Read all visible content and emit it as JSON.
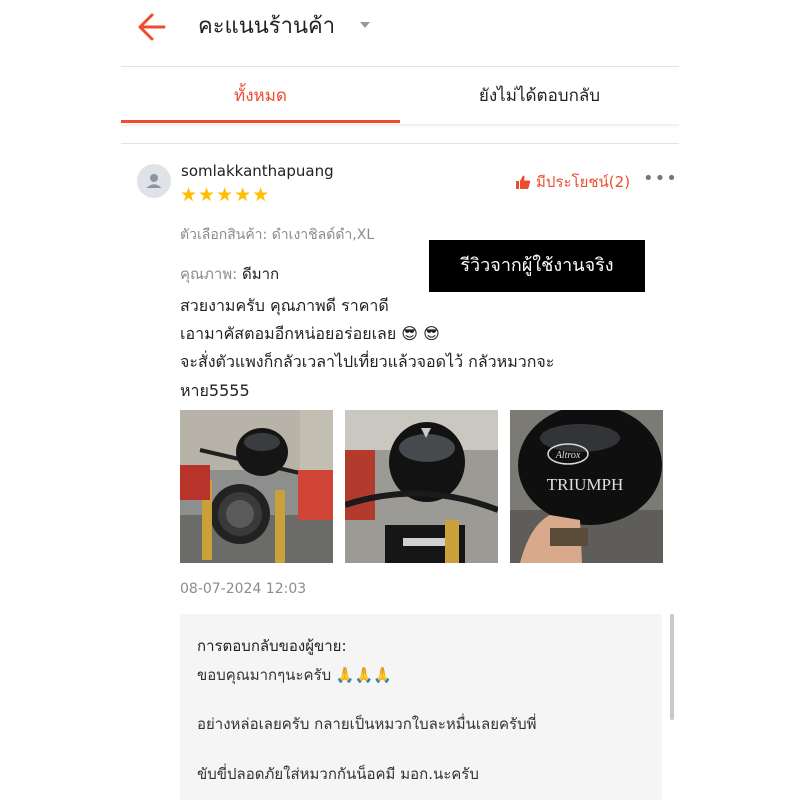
{
  "header": {
    "back_icon": "arrow-left-icon",
    "title": "คะแนนร้านค้า",
    "dropdown_icon": "caret-down-icon",
    "accent_color": "#ee4d2d"
  },
  "tabs": [
    {
      "label": "ทั้งหมด",
      "active": true
    },
    {
      "label": "ยังไม่ได้ตอบกลับ",
      "active": false
    }
  ],
  "review": {
    "username": "somlakkanthapuang",
    "rating": 5,
    "stars": "★★★★★",
    "star_color": "#ffbf00",
    "helpful_label": "มีประโยชน์(2)",
    "more_icon": "•••",
    "variation": "ตัวเลือกสินค้า: ดำเงาชิลด์ดำ,XL",
    "quality_label": "คุณภาพ:",
    "quality_value": "ดีมาก",
    "badge_text": "รีวิวจากผู้ใช้งานจริง",
    "text_lines": [
      "สวยงามครับ คุณภาพดี ราคาดี",
      "เอามาคัสตอมอีกหน่อยอร่อยเลย 😎 😎",
      "จะสั่งตัวแพงก็กลัวเวลาไปเที่ยวแล้วจอดไว้ กลัวหมวกจะ",
      "หาย5555"
    ],
    "photos": [
      {
        "name": "helmet-on-motorcycle-photo-1"
      },
      {
        "name": "helmet-on-motorcycle-photo-2"
      },
      {
        "name": "helmet-in-hand-photo",
        "helmet_text": [
          "Altrox",
          "TRIUMPH"
        ]
      }
    ],
    "timestamp": "08-07-2024 12:03"
  },
  "seller_reply": {
    "title": "การตอบกลับของผู้ขาย:",
    "lines": [
      "ขอบคุณมากๆนะครับ 🙏🙏🙏",
      "อย่างหล่อเลยครับ กลายเป็นหมวกใบละหมื่นเลยครับพี่",
      "ขับขี่ปลอดภัยใส่หมวกกันน็อคมี มอก.นะครับ"
    ]
  }
}
